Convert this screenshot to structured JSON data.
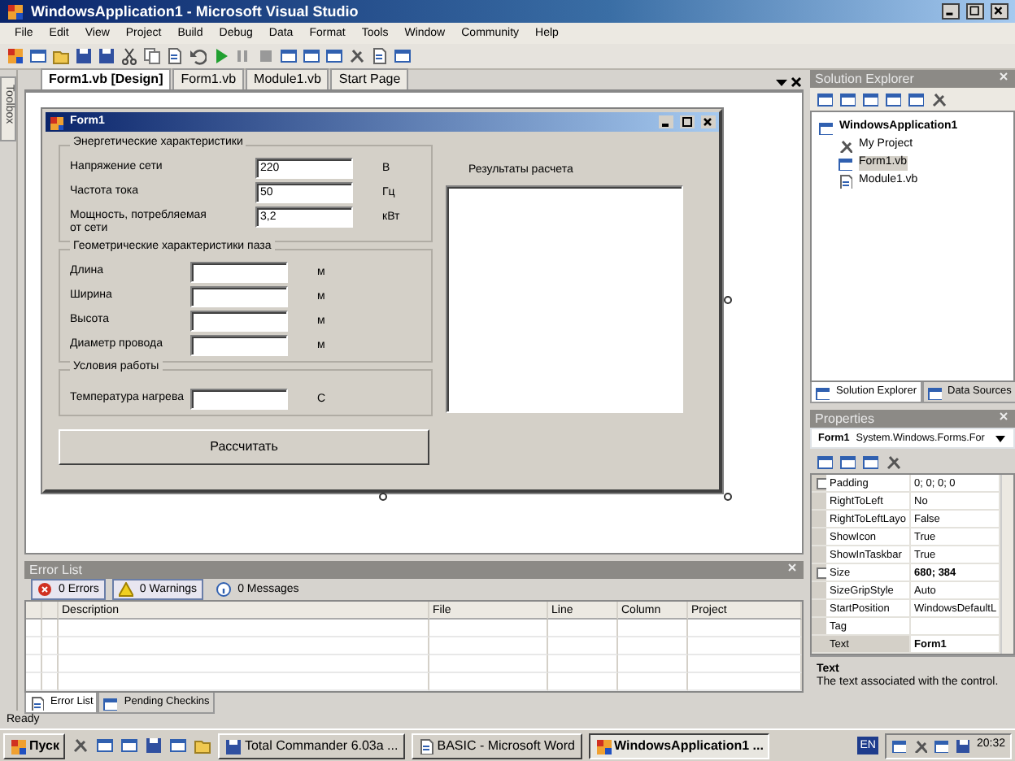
{
  "window": {
    "title": "WindowsApplication1 - Microsoft Visual Studio"
  },
  "menu": [
    "File",
    "Edit",
    "View",
    "Project",
    "Build",
    "Debug",
    "Data",
    "Format",
    "Tools",
    "Window",
    "Community",
    "Help"
  ],
  "toolbox": {
    "label": "Toolbox"
  },
  "document_tabs": [
    {
      "label": "Form1.vb [Design]",
      "selected": true
    },
    {
      "label": "Form1.vb",
      "selected": false
    },
    {
      "label": "Module1.vb",
      "selected": false
    },
    {
      "label": "Start Page",
      "selected": false
    }
  ],
  "form": {
    "title": "Form1",
    "groups": [
      {
        "title": "Энергетические характеристики",
        "fields": [
          {
            "label": "Напряжение сети",
            "value": "220",
            "unit": "В"
          },
          {
            "label": "Частота тока",
            "value": "50",
            "unit": "Гц"
          },
          {
            "label": "Мощность, потребляемая от сети",
            "value": "3,2",
            "unit": "кВт"
          }
        ]
      },
      {
        "title": "Геометрические характеристики паза",
        "fields": [
          {
            "label": "Длина",
            "unit": "м"
          },
          {
            "label": "Ширина",
            "unit": "м"
          },
          {
            "label": "Высота",
            "unit": "м"
          },
          {
            "label": "Диаметр провода",
            "unit": "м"
          }
        ]
      },
      {
        "title": "Условия работы",
        "fields": [
          {
            "label": "Температура нагрева",
            "unit": "С"
          }
        ]
      }
    ],
    "results_label": "Результаты расчета",
    "button": "Рассчитать"
  },
  "solution_explorer": {
    "title": "Solution Explorer",
    "tree": [
      {
        "label": "WindowsApplication1",
        "kind": "solution",
        "selected": false,
        "children": [
          {
            "label": "My Project",
            "kind": "project",
            "selected": false
          },
          {
            "label": "Form1.vb",
            "kind": "form",
            "selected": true
          },
          {
            "label": "Module1.vb",
            "kind": "module",
            "selected": false
          }
        ]
      }
    ],
    "tabs": [
      {
        "label": "Solution Explorer",
        "selected": true
      },
      {
        "label": "Data Sources",
        "selected": false
      }
    ]
  },
  "properties": {
    "title": "Properties",
    "object": "Form1",
    "type": "System.Windows.Forms.For",
    "rows": [
      {
        "name": "Padding",
        "value": "0; 0; 0; 0",
        "expandable": true,
        "modified": false,
        "selected": false
      },
      {
        "name": "RightToLeft",
        "value": "No",
        "expandable": false,
        "modified": false,
        "selected": false
      },
      {
        "name": "RightToLeftLayo",
        "value": "False",
        "expandable": false,
        "modified": false,
        "selected": false
      },
      {
        "name": "ShowIcon",
        "value": "True",
        "expandable": false,
        "modified": false,
        "selected": false
      },
      {
        "name": "ShowInTaskbar",
        "value": "True",
        "expandable": false,
        "modified": false,
        "selected": false
      },
      {
        "name": "Size",
        "value": "680; 384",
        "expandable": true,
        "modified": true,
        "selected": false
      },
      {
        "name": "SizeGripStyle",
        "value": "Auto",
        "expandable": false,
        "modified": false,
        "selected": false
      },
      {
        "name": "StartPosition",
        "value": "WindowsDefaultL",
        "expandable": false,
        "modified": false,
        "selected": false
      },
      {
        "name": "Tag",
        "expandable": false,
        "selected": false
      },
      {
        "name": "Text",
        "value": "Form1",
        "expandable": false,
        "modified": true,
        "selected": true
      }
    ],
    "description_title": "Text",
    "description": "The text associated with the control."
  },
  "error_list": {
    "title": "Error List",
    "filters": [
      {
        "label": "0 Errors",
        "kind": "error",
        "selected": true
      },
      {
        "label": "0 Warnings",
        "kind": "warning",
        "selected": true
      },
      {
        "label": "0 Messages",
        "kind": "info",
        "selected": false
      }
    ],
    "columns": [
      "Description",
      "File",
      "Line",
      "Column",
      "Project"
    ],
    "tabs": [
      {
        "label": "Error List",
        "selected": true
      },
      {
        "label": "Pending Checkins",
        "selected": false
      }
    ]
  },
  "status_bar": "Ready",
  "taskbar": {
    "start": "Пуск",
    "tasks": [
      {
        "label": "Total Commander 6.03a ...",
        "selected": false
      },
      {
        "label": "BASIC - Microsoft Word",
        "selected": false
      },
      {
        "label": "WindowsApplication1 ...",
        "selected": true
      }
    ],
    "language": "EN",
    "clock": "20:32"
  }
}
